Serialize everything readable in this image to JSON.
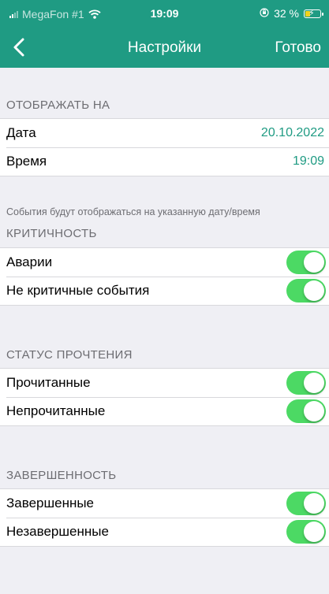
{
  "status_bar": {
    "carrier": "MegaFon #1",
    "time": "19:09",
    "battery_text": "32 %",
    "battery_level": 0.32,
    "icons": [
      "signal-icon",
      "wifi-icon",
      "orientation-lock-icon",
      "battery-charging-icon"
    ]
  },
  "nav": {
    "back_icon": "chevron-left-icon",
    "title": "Настройки",
    "done_label": "Готово"
  },
  "sections": {
    "display": {
      "header": "ОТОБРАЖАТЬ НА",
      "date_label": "Дата",
      "date_value": "20.10.2022",
      "time_label": "Время",
      "time_value": "19:09",
      "footnote": "События будут отображаться на указанную дату/время"
    },
    "criticality": {
      "header": "КРИТИЧНОСТЬ",
      "items": [
        {
          "label": "Аварии",
          "enabled": true
        },
        {
          "label": "Не критичные события",
          "enabled": true
        }
      ]
    },
    "read_status": {
      "header": "СТАТУС ПРОЧТЕНИЯ",
      "items": [
        {
          "label": "Прочитанные",
          "enabled": true
        },
        {
          "label": "Непрочитанные",
          "enabled": true
        }
      ]
    },
    "completion": {
      "header": "ЗАВЕРШЕННОСТЬ",
      "items": [
        {
          "label": "Завершенные",
          "enabled": true
        },
        {
          "label": "Незавершенные",
          "enabled": true
        }
      ]
    }
  },
  "colors": {
    "brand": "#1f9b83",
    "accent_text": "#1f9b83",
    "toggle_on": "#4cd964",
    "background": "#efeff4"
  }
}
